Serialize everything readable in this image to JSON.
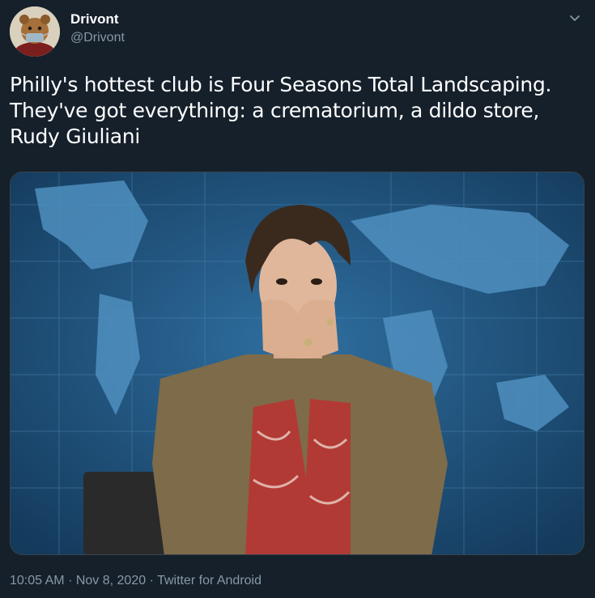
{
  "tweet": {
    "author": {
      "display_name": "Drivont",
      "handle": "@Drivont"
    },
    "text_lines": [
      "Philly's hottest club is Four Seasons Total Landscaping.",
      "They've got everything: a crematorium, a dildo store,",
      "Rudy Giuliani"
    ],
    "timestamp": "10:05 AM",
    "date": "Nov 8, 2020",
    "source": "Twitter for Android",
    "separator": "·"
  },
  "icons": {
    "more": "chevron-down-icon"
  },
  "colors": {
    "background": "#15202b",
    "secondary_text": "#8899a6",
    "border": "#38444d"
  }
}
